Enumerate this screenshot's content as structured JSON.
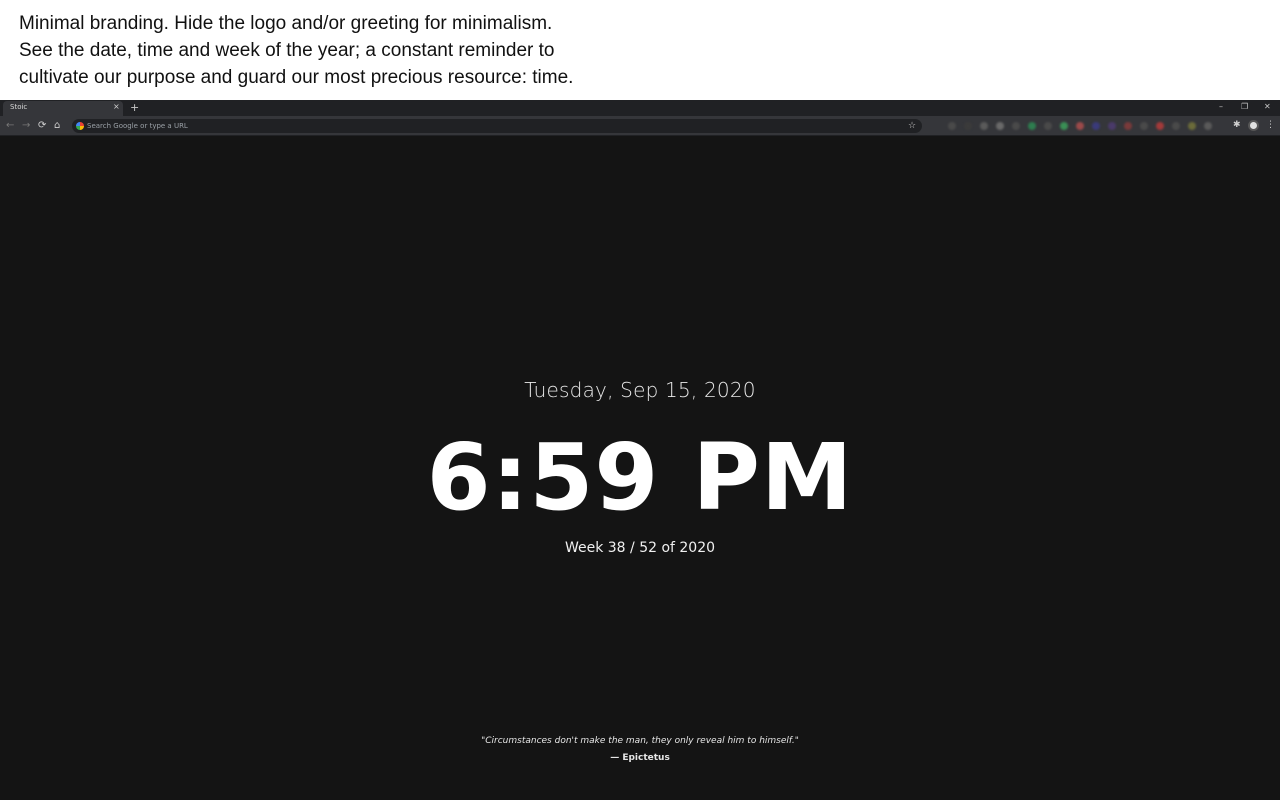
{
  "promo": {
    "lines": [
      "Minimal branding. Hide the logo and/or greeting for minimalism.",
      "See the date, time and week of the year; a constant reminder to",
      "cultivate our purpose and guard our most precious resource: time."
    ]
  },
  "browser": {
    "tab": {
      "title": "Stoic",
      "close": "×"
    },
    "new_tab": "+",
    "window_controls": {
      "minimize": "–",
      "restore": "❐",
      "close": "✕"
    },
    "nav": {
      "back": "←",
      "forward": "→",
      "reload": "⟳",
      "home": "⌂"
    },
    "omnibox": {
      "placeholder": "Search Google or type a URL",
      "value": ""
    },
    "star": "☆",
    "extensions_icon": "✱",
    "menu": "⋮",
    "extension_colors": [
      "#4a4a4a",
      "#3b3b3b",
      "#5a5a5a",
      "#6a6a6a",
      "#4a4a4a",
      "#2e7d4f",
      "#4a4a4a",
      "#3a8f55",
      "#9c4a4a",
      "#3a3a7a",
      "#4a3a6a",
      "#7a3a3a",
      "#4a4a4a",
      "#a33a3a",
      "#4a4a4a",
      "#6b6b3a",
      "#5a5a5a"
    ]
  },
  "dashboard": {
    "date": "Tuesday, Sep 15, 2020",
    "time": "6:59 PM",
    "week": "Week 38 / 52 of 2020",
    "quote": "\"Circumstances don't make the man, they only reveal him to himself.\"",
    "author": "— Epictetus"
  },
  "colors": {
    "background": "#141414",
    "tabstrip": "#202124",
    "toolbar": "#35363a",
    "text": "#ffffff"
  }
}
